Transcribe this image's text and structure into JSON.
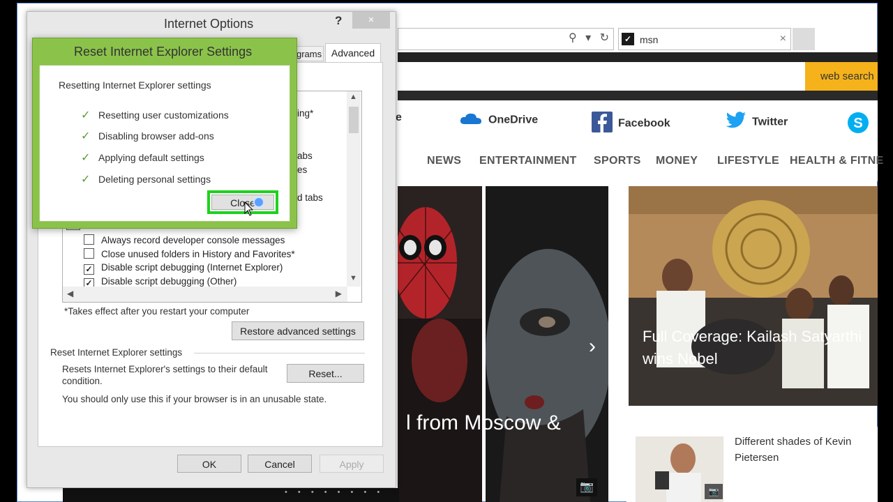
{
  "browser": {
    "tab_title": "msn",
    "tab_close": "×",
    "address_icons": "⚲ ▾ ↻",
    "web_search_label": "web search",
    "quick_links": [
      {
        "label": "e",
        "icon": "partial"
      },
      {
        "label": "OneDrive",
        "icon": "cloud"
      },
      {
        "label": "Facebook",
        "icon": "facebook"
      },
      {
        "label": "Twitter",
        "icon": "twitter"
      },
      {
        "label": "",
        "icon": "skype"
      }
    ],
    "nav": [
      "NEWS",
      "ENTERTAINMENT",
      "SPORTS",
      "MONEY",
      "LIFESTYLE",
      "HEALTH & FITNE"
    ],
    "hero_caption": "l from Moscow &",
    "hero_arrow": "›",
    "news_caption": "Full Coverage: Kailash Satyarthi wins Nobel",
    "card_title": "Different shades of Kevin Pietersen",
    "carousel_dots": "• • • • • • • •"
  },
  "internet_options": {
    "title": "Internet Options",
    "help": "?",
    "close": "×",
    "tabs": {
      "programs_partial": "grams",
      "advanced": "Advanced"
    },
    "partial_settings": [
      {
        "text": "ing*"
      },
      {
        "text": "abs"
      },
      {
        "text": "es"
      },
      {
        "text": "d tabs"
      }
    ],
    "settings": [
      {
        "label": "Always record developer console messages",
        "checked": false
      },
      {
        "label": "Close unused folders in History and Favorites*",
        "checked": false
      },
      {
        "label": "Disable script debugging (Internet Explorer)",
        "checked": true
      },
      {
        "label": "Disable script debugging (Other)",
        "checked": true
      }
    ],
    "takes_effect_note": "*Takes effect after you restart your computer",
    "restore_button": "Restore advanced settings",
    "reset_group_label": "Reset Internet Explorer settings",
    "reset_description": "Resets Internet Explorer's settings to their default condition.",
    "reset_button": "Reset...",
    "unusable_note": "You should only use this if your browser is in an unusable state.",
    "ok_button": "OK",
    "cancel_button": "Cancel",
    "apply_button": "Apply"
  },
  "reset_dialog": {
    "title": "Reset Internet Explorer Settings",
    "progress_label": "Resetting Internet Explorer settings",
    "steps": [
      "Resetting user customizations",
      "Disabling browser add-ons",
      "Applying default settings",
      "Deleting personal settings"
    ],
    "close_button": "Close",
    "accent_color": "#8bc34a",
    "highlight_color": "#1ed21e"
  }
}
